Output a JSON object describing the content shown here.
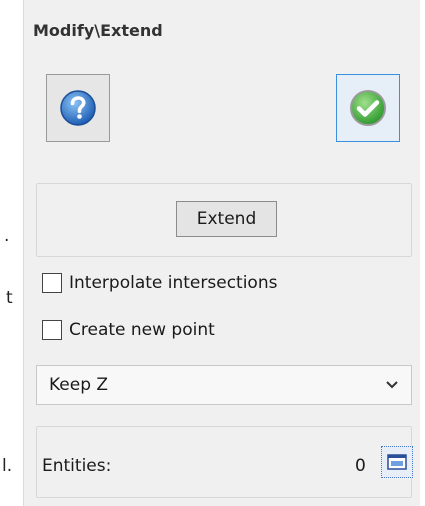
{
  "background_fragments": [
    ".",
    "t",
    "l."
  ],
  "panel": {
    "title": "Modify\\Extend",
    "help_icon": "question-mark-icon",
    "ok_icon": "green-checkmark-icon",
    "extend_label": "Extend",
    "options": [
      {
        "label": "Interpolate intersections",
        "checked": false
      },
      {
        "label": "Create new point",
        "checked": false
      }
    ],
    "z_mode": {
      "selected": "Keep Z"
    },
    "entities": {
      "label": "Entities:",
      "count": "0",
      "select_icon": "window-select-icon"
    }
  },
  "colors": {
    "accent": "#3c8fe0",
    "ok_green": "#3fae3f",
    "help_blue": "#2a6fc9"
  }
}
